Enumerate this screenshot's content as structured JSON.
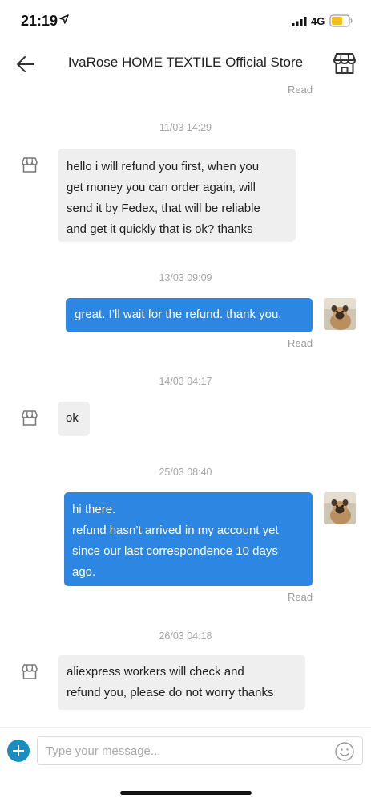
{
  "status_bar": {
    "time": "21:19",
    "network": "4G",
    "icons": [
      "location-arrow-icon",
      "signal-icon",
      "battery-icon"
    ],
    "battery_color": "#f2c11c"
  },
  "header": {
    "title": "IvaRose HOME TEXTILE Official Store",
    "back_icon": "back-arrow-icon",
    "store_icon": "store-icon"
  },
  "chat": {
    "top_read": "Read",
    "messages": [
      {
        "timestamp": "11/03 14:29",
        "from": "seller",
        "lines": [
          "hello i will refund you first,  when you",
          "get money you can order again, will",
          "send it by Fedex, that will be reliable",
          "and get it quickly that is ok? thanks"
        ]
      },
      {
        "timestamp": "13/03 09:09",
        "from": "buyer",
        "lines": [
          "great. I’ll wait for the refund. thank you."
        ],
        "status": "Read"
      },
      {
        "timestamp": "14/03 04:17",
        "from": "seller",
        "lines": [
          "ok"
        ]
      },
      {
        "timestamp": "25/03 08:40",
        "from": "buyer",
        "lines": [
          "hi there.",
          "refund hasn’t arrived in my account yet",
          "since our last correspondence 10 days",
          "ago."
        ],
        "status": "Read"
      },
      {
        "timestamp": "26/03 04:18",
        "from": "seller",
        "lines": [
          "aliexpress workers will check and",
          "refund you, please do not worry thanks"
        ]
      }
    ]
  },
  "composer": {
    "placeholder": "Type your message...",
    "add_icon": "plus-icon",
    "emoji_icon": "emoji-smile-icon",
    "accent": "#1a8fbf"
  },
  "colors": {
    "outgoing_bubble": "#2e86e3",
    "incoming_bubble": "#efefef"
  }
}
